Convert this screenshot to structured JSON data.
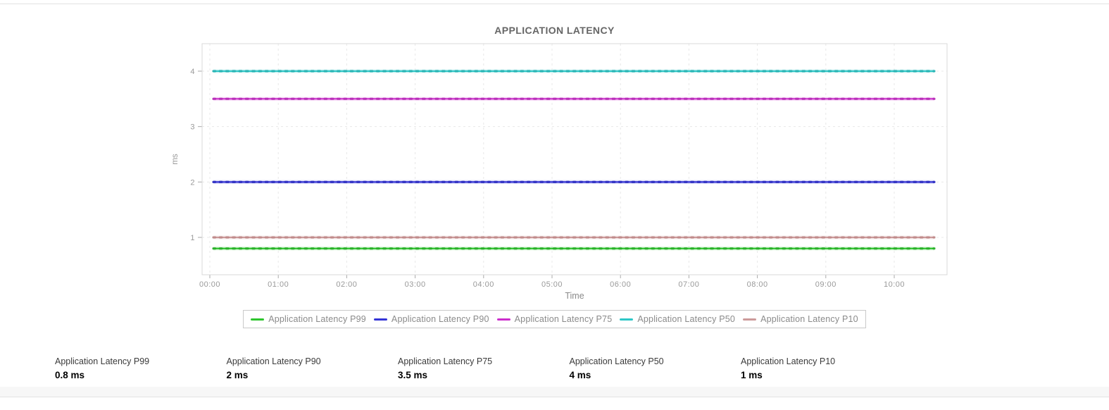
{
  "chart_data": {
    "type": "line",
    "title": "APPLICATION LATENCY",
    "xlabel": "Time",
    "ylabel": "ms",
    "x_ticks": [
      "00:00",
      "01:00",
      "02:00",
      "03:00",
      "04:00",
      "05:00",
      "06:00",
      "07:00",
      "08:00",
      "09:00",
      "10:00"
    ],
    "y_ticks": [
      "1",
      "2",
      "3",
      "4"
    ],
    "ylim": [
      0.35,
      4.5
    ],
    "x_range": [
      "00:00",
      "10:45"
    ],
    "grid": "dashed",
    "legend_position": "bottom",
    "series": [
      {
        "key": "p99",
        "name": "Application Latency P99",
        "value": 0.8,
        "color": "#2ec52e",
        "dot_color": "#1ea11e"
      },
      {
        "key": "p90",
        "name": "Application Latency P90",
        "value": 2,
        "color": "#3434d6",
        "dot_color": "#1d1db4"
      },
      {
        "key": "p75",
        "name": "Application Latency P75",
        "value": 3.5,
        "color": "#cc2ecc",
        "dot_color": "#a91ea9"
      },
      {
        "key": "p50",
        "name": "Application Latency P50",
        "value": 4,
        "color": "#2ec7c7",
        "dot_color": "#1ba6a6"
      },
      {
        "key": "p10",
        "name": "Application Latency P10",
        "value": 1,
        "color": "#cc9a9a",
        "dot_color": "#b88080"
      }
    ]
  },
  "stats": [
    {
      "key": "p99",
      "label": "Application Latency P99",
      "value": "0.8 ms"
    },
    {
      "key": "p90",
      "label": "Application Latency P90",
      "value": "2 ms"
    },
    {
      "key": "p75",
      "label": "Application Latency P75",
      "value": "3.5 ms"
    },
    {
      "key": "p50",
      "label": "Application Latency P50",
      "value": "4 ms"
    },
    {
      "key": "p10",
      "label": "Application Latency P10",
      "value": "1 ms"
    }
  ]
}
